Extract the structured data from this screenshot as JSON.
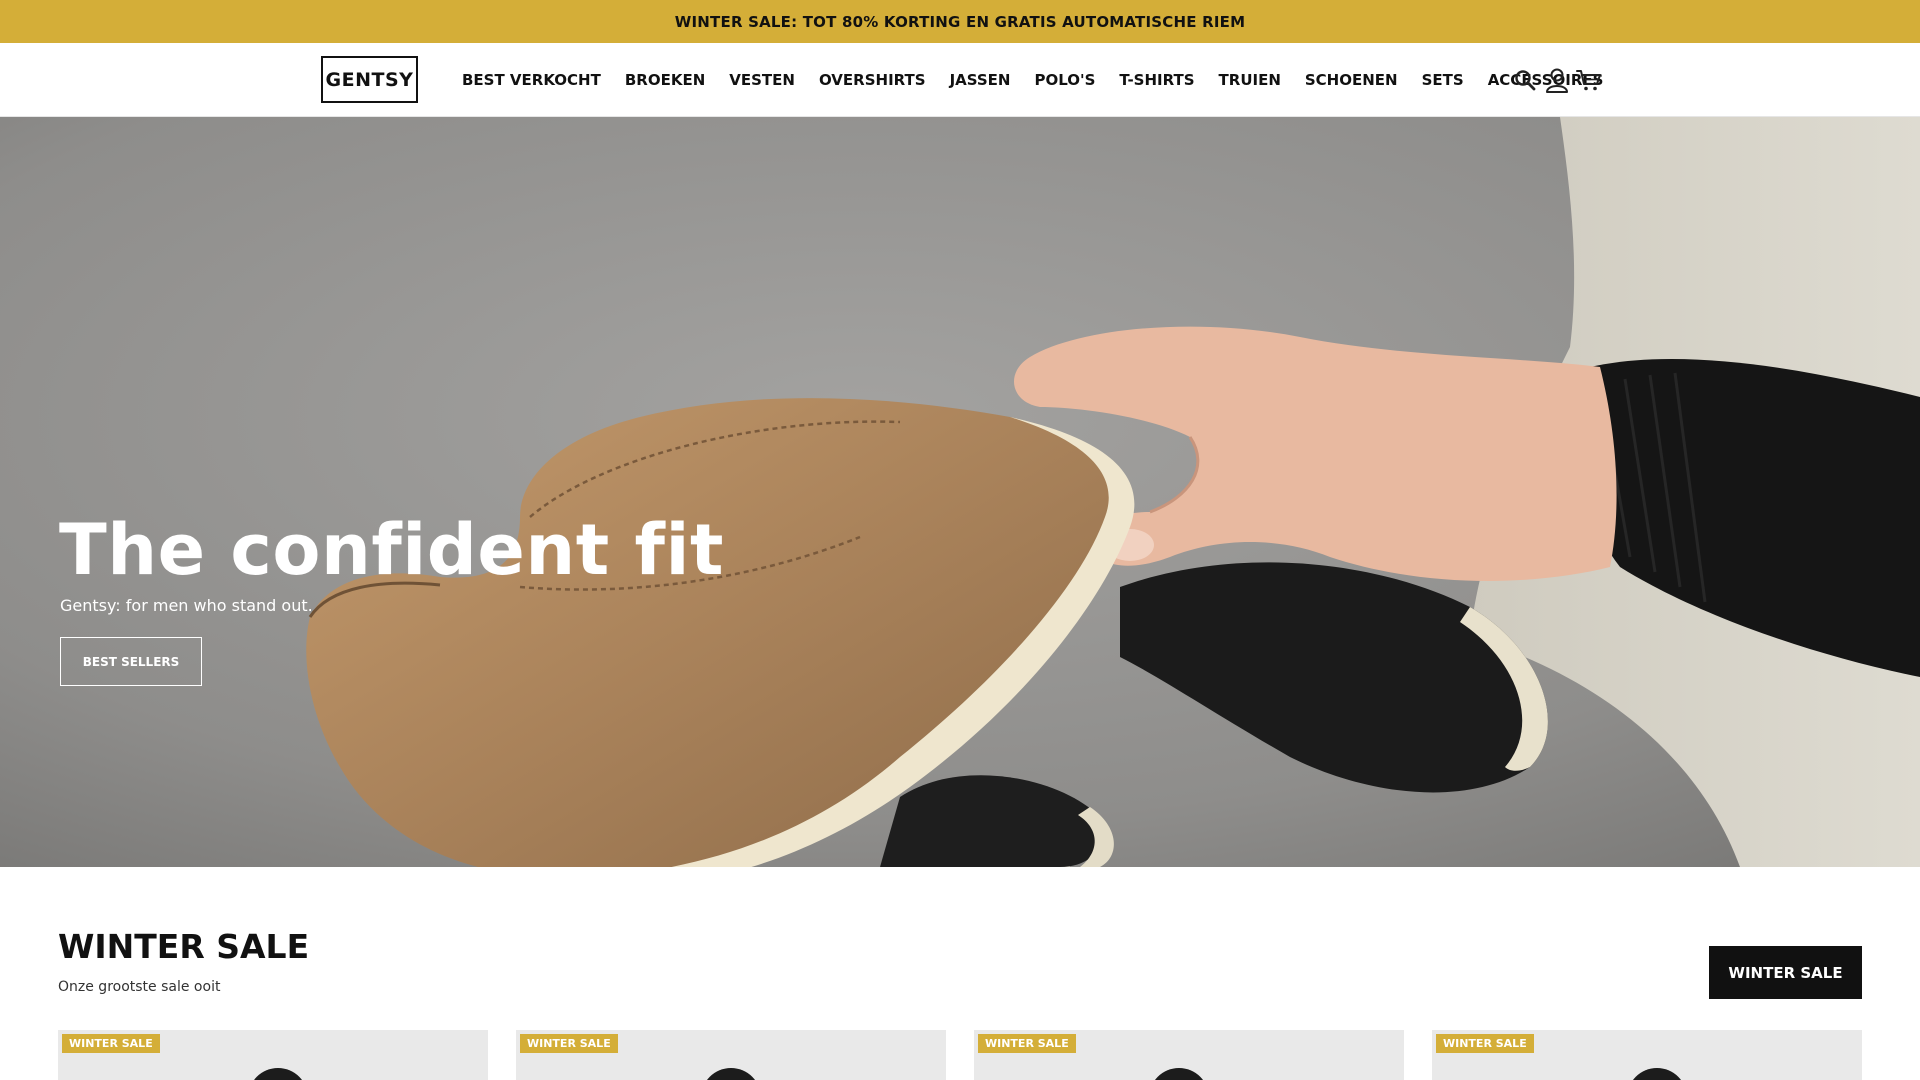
{
  "announcement": {
    "text": "WINTER SALE: TOT 80% KORTING EN GRATIS AUTOMATISCHE RIEM"
  },
  "header": {
    "logo": "GENTSY",
    "nav": [
      {
        "label": "BEST VERKOCHT"
      },
      {
        "label": "BROEKEN"
      },
      {
        "label": "VESTEN"
      },
      {
        "label": "OVERSHIRTS"
      },
      {
        "label": "JASSEN"
      },
      {
        "label": "POLO'S"
      },
      {
        "label": "T-SHIRTS"
      },
      {
        "label": "TRUIEN"
      },
      {
        "label": "SCHOENEN"
      },
      {
        "label": "SETS"
      },
      {
        "label": "ACCESSOIRES"
      }
    ],
    "icons": [
      "search-icon",
      "account-icon",
      "cart-icon"
    ]
  },
  "hero": {
    "title": "The confident fit",
    "subtitle": "Gentsy: for men who stand out.",
    "button": "BEST SELLERS"
  },
  "section": {
    "title": "WINTER SALE",
    "subtitle": "Onze grootste sale ooit",
    "button": "WINTER SALE",
    "cards": [
      {
        "badge": "WINTER SALE"
      },
      {
        "badge": "WINTER SALE"
      },
      {
        "badge": "WINTER SALE"
      },
      {
        "badge": "WINTER SALE"
      }
    ]
  },
  "colors": {
    "accent": "#d4ae38",
    "text": "#111111",
    "button_dark": "#111111"
  }
}
